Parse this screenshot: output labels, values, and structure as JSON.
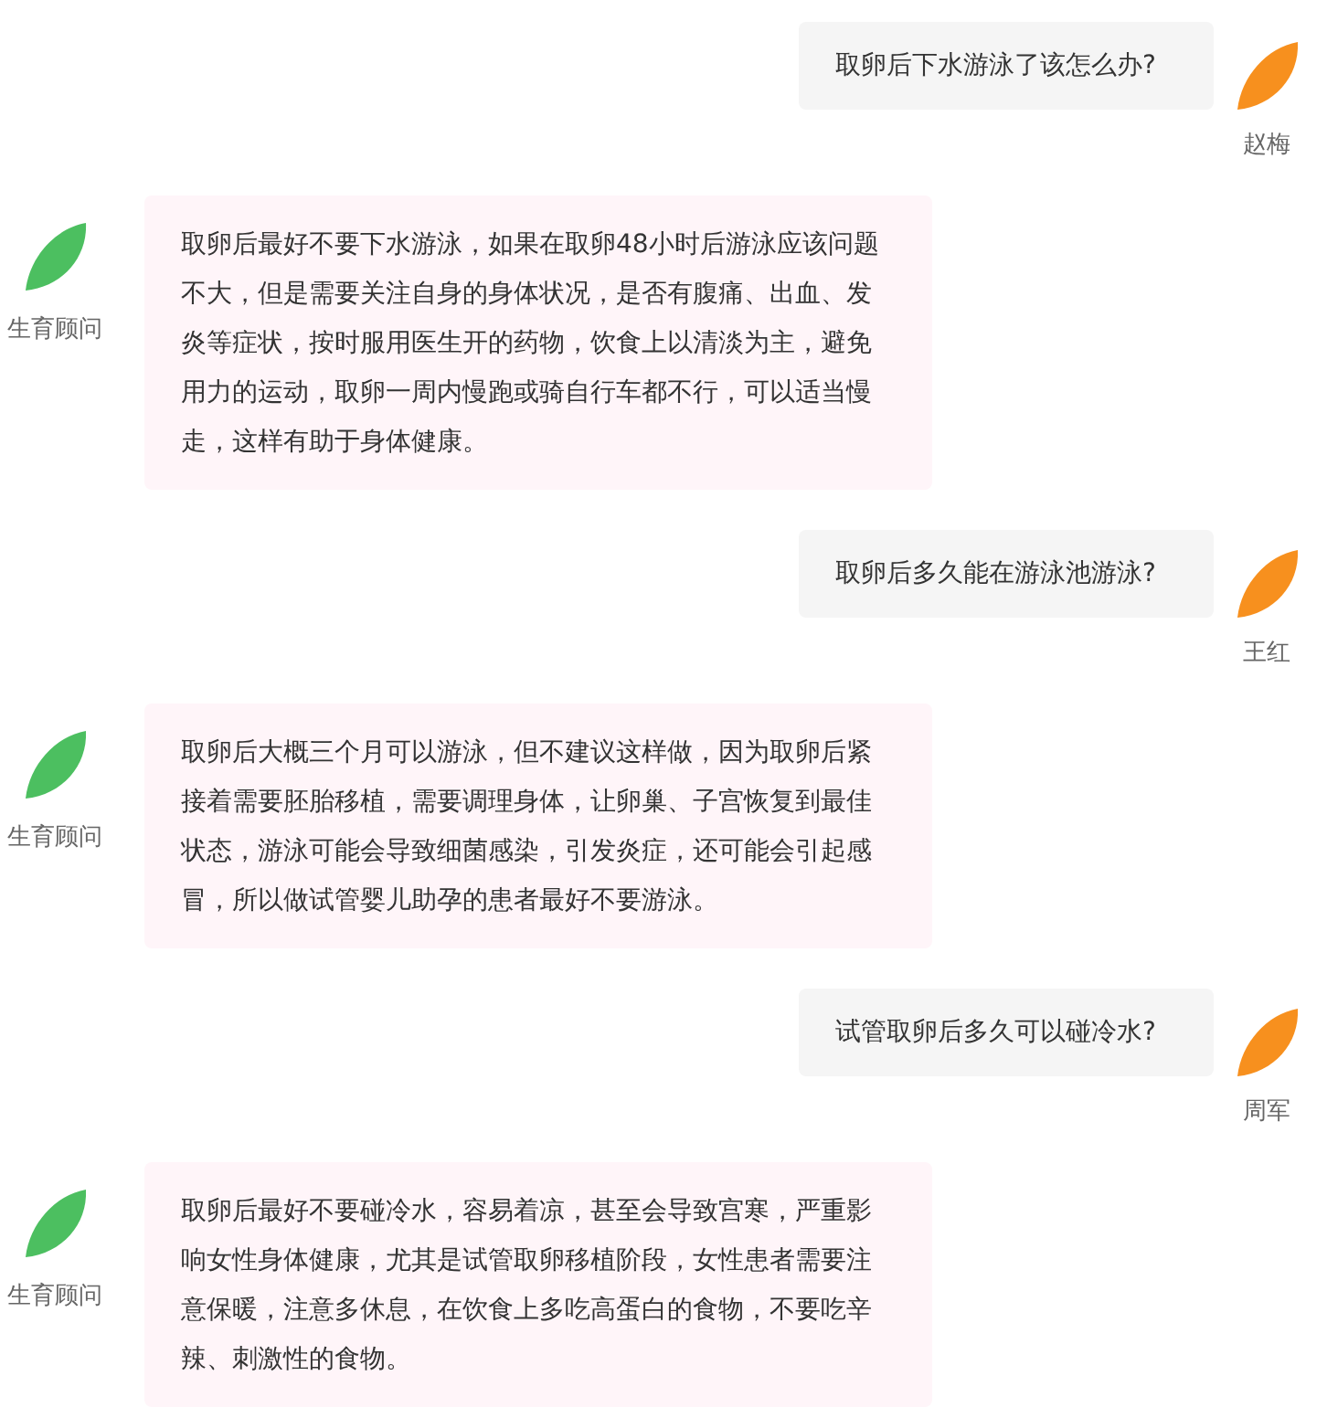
{
  "messages": [
    {
      "kind": "question",
      "name": "赵梅",
      "text": "取卵后下水游泳了该怎么办?"
    },
    {
      "kind": "answer",
      "name": "生育顾问",
      "text": "取卵后最好不要下水游泳，如果在取卵48小时后游泳应该问题不大，但是需要关注自身的身体状况，是否有腹痛、出血、发炎等症状，按时服用医生开的药物，饮食上以清淡为主，避免用力的运动，取卵一周内慢跑或骑自行车都不行，可以适当慢走，这样有助于身体健康。"
    },
    {
      "kind": "question",
      "name": "王红",
      "text": "取卵后多久能在游泳池游泳?"
    },
    {
      "kind": "answer",
      "name": "生育顾问",
      "text": "取卵后大概三个月可以游泳，但不建议这样做，因为取卵后紧接着需要胚胎移植，需要调理身体，让卵巢、子宫恢复到最佳状态，游泳可能会导致细菌感染，引发炎症，还可能会引起感冒，所以做试管婴儿助孕的患者最好不要游泳。"
    },
    {
      "kind": "question",
      "name": "周军",
      "text": "试管取卵后多久可以碰冷水?"
    },
    {
      "kind": "answer",
      "name": "生育顾问",
      "text": "取卵后最好不要碰冷水，容易着凉，甚至会导致宫寒，严重影响女性身体健康，尤其是试管取卵移植阶段，女性患者需要注意保暖，注意多休息，在饮食上多吃高蛋白的食物，不要吃辛辣、刺激性的食物。"
    }
  ]
}
